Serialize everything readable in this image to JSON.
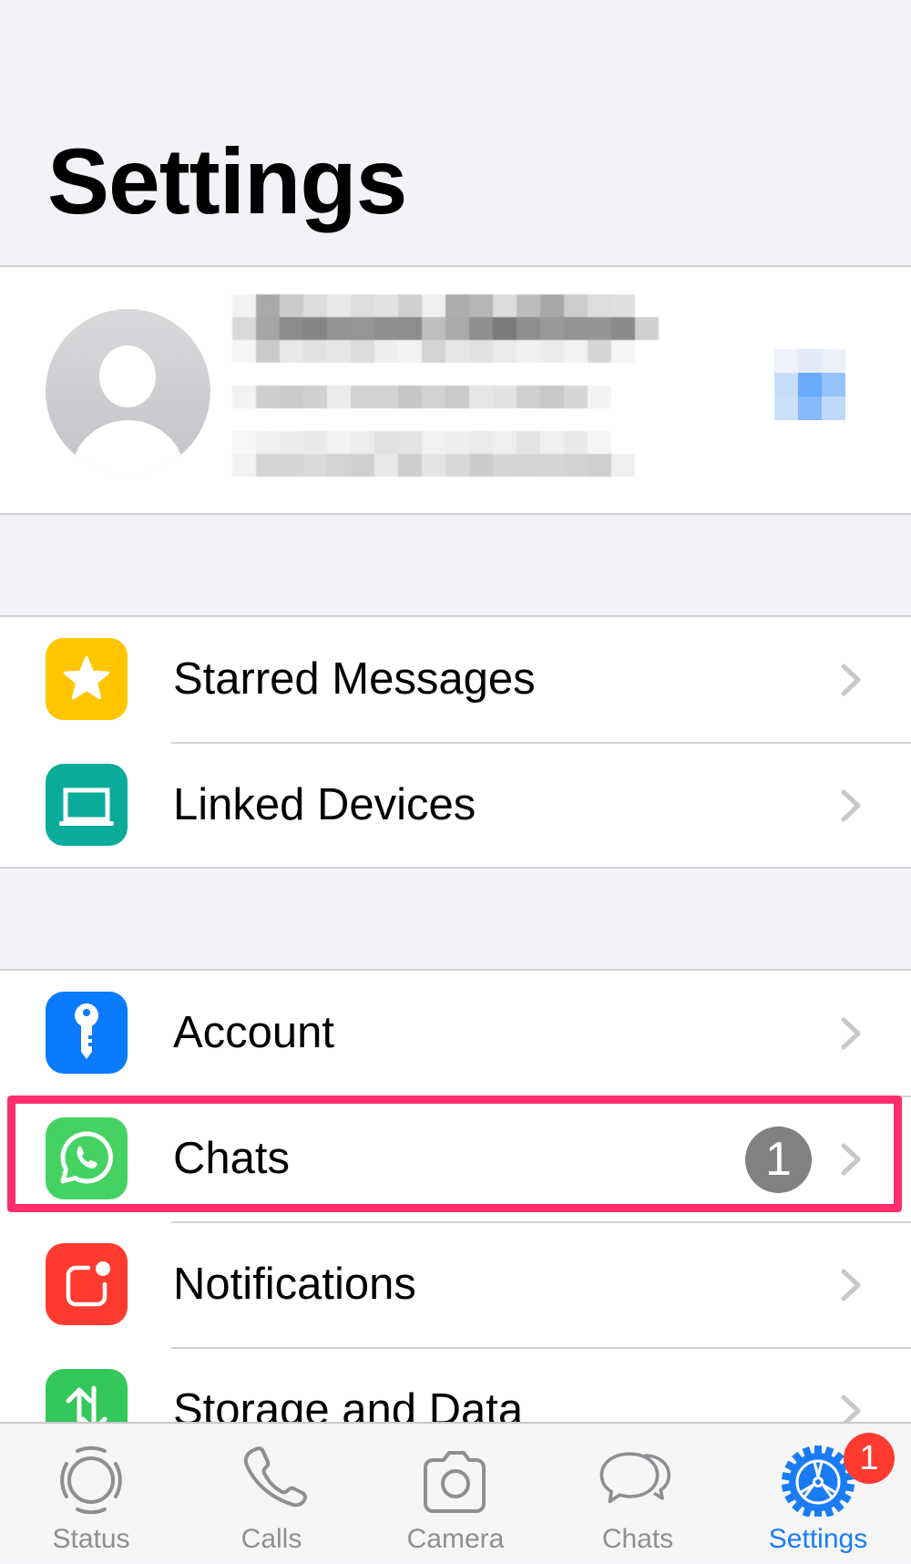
{
  "header": {
    "title": "Settings"
  },
  "profile": {
    "name": "[redacted]",
    "about": "[redacted]",
    "phone": "[redacted]",
    "qr_icon": "qr-code-icon"
  },
  "groups": [
    {
      "items": [
        {
          "label": "Starred Messages",
          "icon": "star-icon",
          "icon_color": "#ffc600"
        },
        {
          "label": "Linked Devices",
          "icon": "laptop-icon",
          "icon_color": "#0aab9b"
        }
      ]
    },
    {
      "items": [
        {
          "label": "Account",
          "icon": "key-icon",
          "icon_color": "#0a7aff"
        },
        {
          "label": "Chats",
          "icon": "whatsapp-icon",
          "icon_color": "#44d363",
          "badge": "1",
          "highlighted": true
        },
        {
          "label": "Notifications",
          "icon": "notification-icon",
          "icon_color": "#ff3b30"
        },
        {
          "label": "Storage and Data",
          "icon": "data-transfer-icon",
          "icon_color": "#34c759"
        }
      ]
    }
  ],
  "highlight_color": "#ff2d6b",
  "tabbar": {
    "active": "Settings",
    "active_color": "#1a7cf5",
    "inactive_color": "#8e8e93",
    "tabs": [
      {
        "label": "Status",
        "icon": "status-icon"
      },
      {
        "label": "Calls",
        "icon": "phone-icon"
      },
      {
        "label": "Camera",
        "icon": "camera-icon"
      },
      {
        "label": "Chats",
        "icon": "chat-bubbles-icon"
      },
      {
        "label": "Settings",
        "icon": "gear-icon",
        "badge": "1"
      }
    ]
  }
}
